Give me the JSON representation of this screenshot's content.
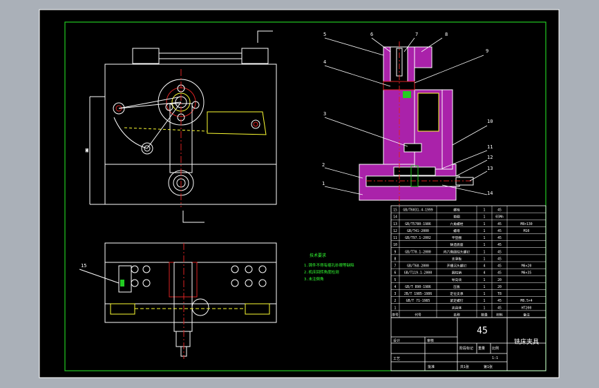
{
  "drawing": {
    "material_code": "45",
    "title": "铣床夹具",
    "balloons": [
      "5",
      "6",
      "7",
      "8",
      "9",
      "4",
      "3",
      "10",
      "2",
      "11",
      "12",
      "13",
      "1",
      "14"
    ],
    "section_balloon": "15",
    "tech_requirements": {
      "heading": "技术要求",
      "lines": [
        "1.铸件不得有缩孔砂眼等缺陷",
        "2.机床回转角度检测",
        "3.未注倒角"
      ]
    },
    "bom_rows": [
      [
        "15",
        "GB/T6031.4-1999",
        "螺栓",
        "1",
        "45",
        ""
      ],
      [
        "14",
        "",
        "垫圈",
        "1",
        "65Mn",
        ""
      ],
      [
        "13",
        "GB/T5780-1986",
        "六角螺栓",
        "1",
        "45",
        "M8×130"
      ],
      [
        "12",
        "GB/T41-2000",
        "螺母",
        "1",
        "45",
        "M10"
      ],
      [
        "11",
        "GB/T97.1-2002",
        "平垫圈",
        "1",
        "45",
        ""
      ],
      [
        "10",
        "",
        "铸造底座",
        "1",
        "45",
        ""
      ],
      [
        "9",
        "GB/T70.1-2000",
        "内六角圆柱头螺钉",
        "1",
        "45",
        ""
      ],
      [
        "8",
        "",
        "支承板",
        "1",
        "45",
        ""
      ],
      [
        "7",
        "GB/T68-2000",
        "开槽沉头螺钉",
        "4",
        "45",
        "M6×20"
      ],
      [
        "6",
        "GB/T119.1-2000",
        "圆柱销",
        "4",
        "45",
        "M6×35"
      ],
      [
        "5",
        "",
        "导向块",
        "1",
        "20",
        ""
      ],
      [
        "4",
        "GB/T 890-1986",
        "压板",
        "1",
        "20",
        ""
      ],
      [
        "3",
        "JB/T 1985-1986",
        "定位支承",
        "1",
        "T8",
        ""
      ],
      [
        "2",
        "GB/T 71-1985",
        "紧定螺钉",
        "1",
        "45",
        "M8.5×4"
      ],
      [
        "1",
        "",
        "夹具体",
        "1",
        "45",
        "HT200"
      ]
    ],
    "header_row": [
      "序号",
      "代号",
      "名称",
      "数量",
      "材料",
      "备注"
    ],
    "title_block": {
      "labels": [
        "标记",
        "处数",
        "分区",
        "更改文件号",
        "签名",
        "年月日"
      ],
      "design": "设计",
      "check": "审核",
      "process": "工艺",
      "approve": "批准",
      "stage": "阶段标记",
      "weight": "重量",
      "scale": "比例",
      "scale_value": "1:1",
      "sheets": "共1张",
      "sheet": "第1张"
    }
  },
  "colors": {
    "background": "#000000",
    "border_outer": "#ffffff",
    "border_inner": "#22cc22",
    "line": "#ffffff",
    "hatch": "#aa22aa",
    "center": "#dd2222",
    "hidden": "#ffff33"
  }
}
